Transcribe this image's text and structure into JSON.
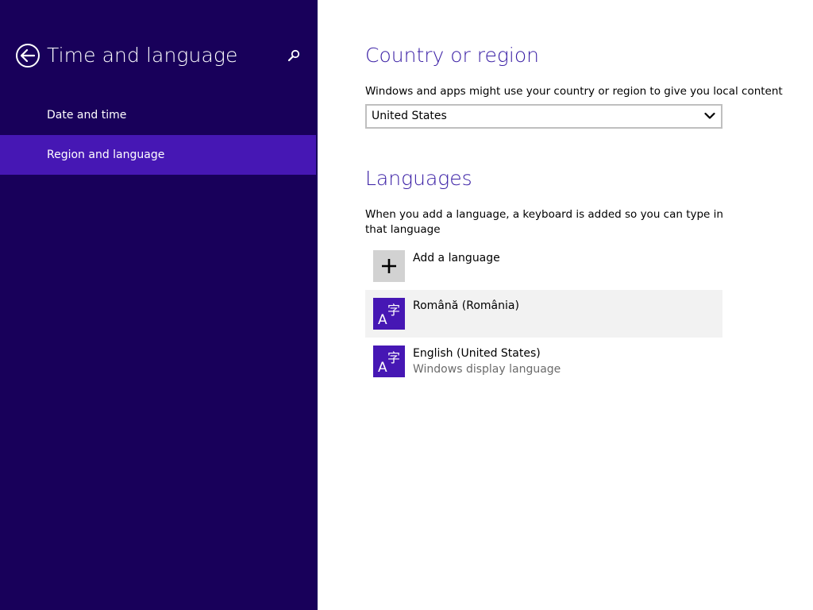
{
  "sidebar": {
    "title": "Time and language",
    "back_icon": "back-arrow-icon",
    "search_icon": "search-icon",
    "items": [
      {
        "label": "Date and time",
        "selected": false
      },
      {
        "label": "Region and language",
        "selected": true
      }
    ],
    "colors": {
      "background": "#18005a",
      "selected": "#4617b4"
    }
  },
  "main": {
    "country": {
      "heading": "Country or region",
      "description": "Windows and apps might use your country or region to give you local content",
      "selected_value": "United States",
      "dropdown_icon": "chevron-down-icon"
    },
    "languages": {
      "heading": "Languages",
      "description": "When you add a language, a keyboard is added so you can type in that language",
      "add_label": "Add a language",
      "add_icon": "plus-icon",
      "items": [
        {
          "name": "Română (România)",
          "subtitle": "",
          "icon": "language-icon"
        },
        {
          "name": "English (United States)",
          "subtitle": "Windows display language",
          "icon": "language-icon"
        }
      ]
    },
    "colors": {
      "heading": "#3a1fa5",
      "tile": "#4617b4",
      "hover_row": "#f2f2f2"
    }
  }
}
